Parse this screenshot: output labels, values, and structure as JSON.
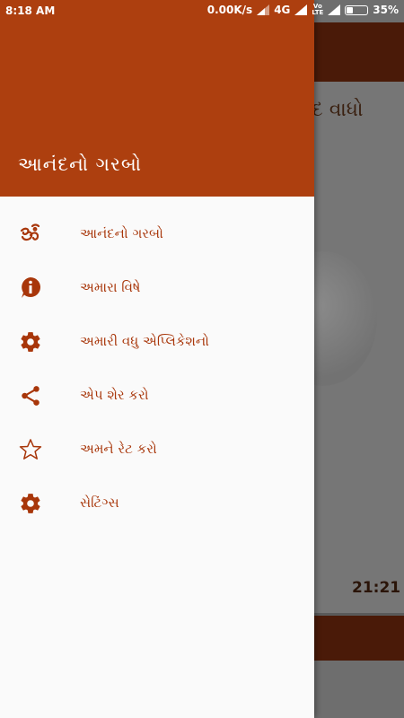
{
  "status_bar": {
    "time": "8:18 AM",
    "network_speed": "0.00K/s",
    "network_type": "4G",
    "volte_top": "Vo",
    "volte_bottom": "LTE",
    "battery": "35%",
    "battery_level": 0.35
  },
  "background_app": {
    "title_fragment": "ંદ વાધો",
    "duration": "21:21"
  },
  "drawer": {
    "header_title": "આનંદનો ગરબો",
    "items": [
      {
        "label": "આનંદનો ગરબો",
        "icon": "om-icon"
      },
      {
        "label": "અમારા વિષે",
        "icon": "info-icon"
      },
      {
        "label": "અમારી વધુ એપ્લિકેશનો",
        "icon": "gear-icon"
      },
      {
        "label": "એપ શેર કરો",
        "icon": "share-icon"
      },
      {
        "label": "અમને રેટ કરો",
        "icon": "star-icon"
      },
      {
        "label": "સેટિંગ્સ",
        "icon": "settings-icon"
      }
    ]
  },
  "colors": {
    "primary": "#ad3f0f",
    "primary_dark": "#4a1a08",
    "accent_text": "#a8360a",
    "drawer_bg": "#fafafa"
  }
}
